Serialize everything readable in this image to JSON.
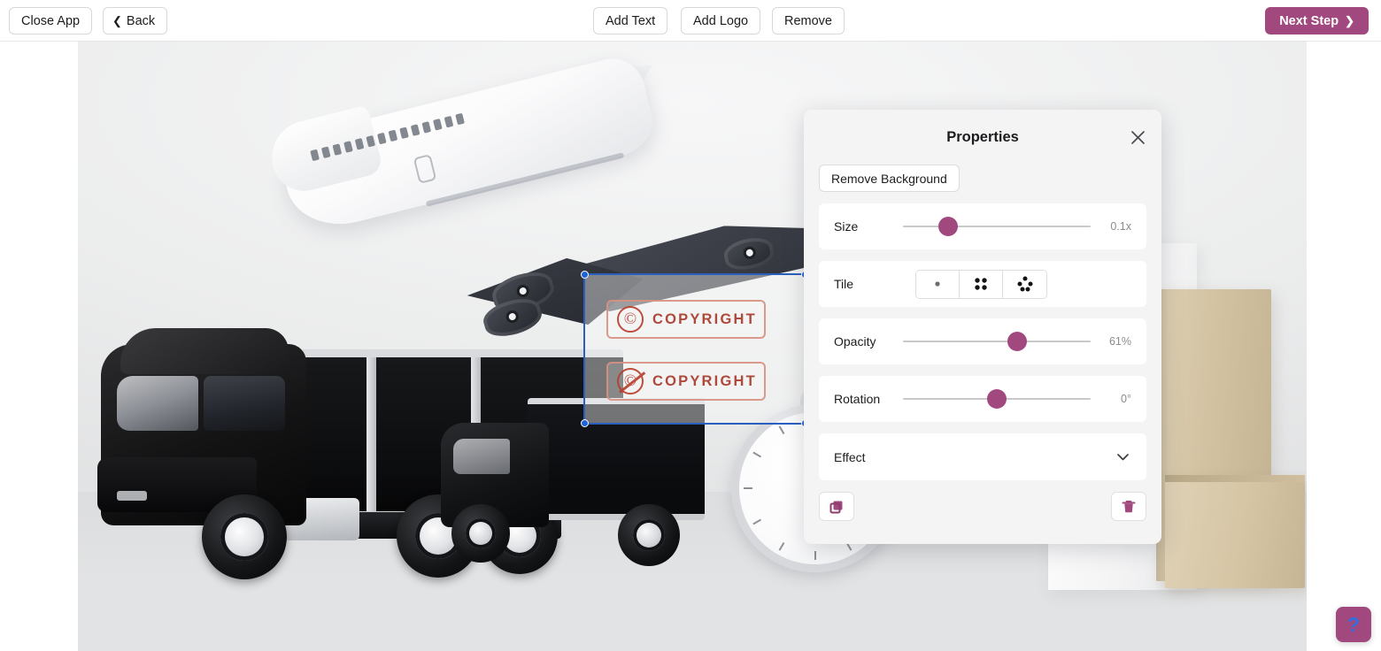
{
  "topbar": {
    "close_app_label": "Close App",
    "back_label": "Back",
    "back_icon": "chevron-left-icon",
    "add_text_label": "Add Text",
    "add_logo_label": "Add Logo",
    "remove_label": "Remove",
    "next_step_label": "Next Step",
    "next_step_icon": "chevron-right-icon",
    "next_step_color": "#a1497e"
  },
  "canvas": {
    "watermark": {
      "stamps": [
        {
          "symbol": "©",
          "label": "COPYRIGHT",
          "icon": "copyright-circle-icon"
        },
        {
          "symbol": "©",
          "label": "COPYRIGHT",
          "icon": "copyright-crossed-icon"
        }
      ],
      "selection_border_color": "#2a5fc0",
      "stamp_color": "#a83c2c"
    }
  },
  "panel": {
    "title": "Properties",
    "close_icon": "close-icon",
    "remove_background_label": "Remove Background",
    "rows": {
      "size": {
        "label": "Size",
        "value": "0.1x",
        "thumb_pct": 24
      },
      "tile": {
        "label": "Tile",
        "options": [
          {
            "icon": "tile-single-dot-icon",
            "selected": false
          },
          {
            "icon": "tile-four-dots-icon",
            "selected": false
          },
          {
            "icon": "tile-five-dots-icon",
            "selected": false
          }
        ]
      },
      "opacity": {
        "label": "Opacity",
        "value": "61%",
        "thumb_pct": 61
      },
      "rotation": {
        "label": "Rotation",
        "value": "0°",
        "thumb_pct": 50
      },
      "effect": {
        "label": "Effect",
        "chevron_icon": "chevron-down-icon"
      }
    },
    "footer": {
      "duplicate_icon": "duplicate-layers-icon",
      "delete_icon": "trash-icon",
      "accent_color": "#a1497e"
    }
  },
  "help": {
    "icon": "question-mark-icon",
    "label": "?"
  }
}
